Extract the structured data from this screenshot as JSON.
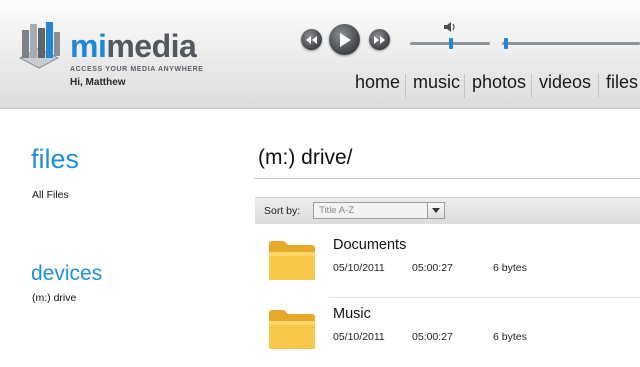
{
  "brand": {
    "name_part1": "mi",
    "name_part2": "media",
    "tagline": "ACCESS YOUR MEDIA ANYWHERE",
    "greeting": "Hi, Matthew",
    "accent_color": "#1f87d6"
  },
  "player": {
    "controls": [
      "rewind-icon",
      "play-icon",
      "fast-forward-icon"
    ],
    "volume_icon": "speaker-icon"
  },
  "nav": {
    "items": [
      "home",
      "music",
      "photos",
      "videos",
      "files"
    ]
  },
  "sidebar": {
    "files_title": "files",
    "files_link": "All Files",
    "devices_title": "devices",
    "devices_link": "(m:) drive"
  },
  "main": {
    "title": "(m:) drive/",
    "sort_label": "Sort by:",
    "sort_value": "Title A-Z",
    "files": [
      {
        "name": "Documents",
        "date": "05/10/2011",
        "time": "05:00:27",
        "size": "6 bytes"
      },
      {
        "name": "Music",
        "date": "05/10/2011",
        "time": "05:00:27",
        "size": "6 bytes"
      }
    ]
  }
}
